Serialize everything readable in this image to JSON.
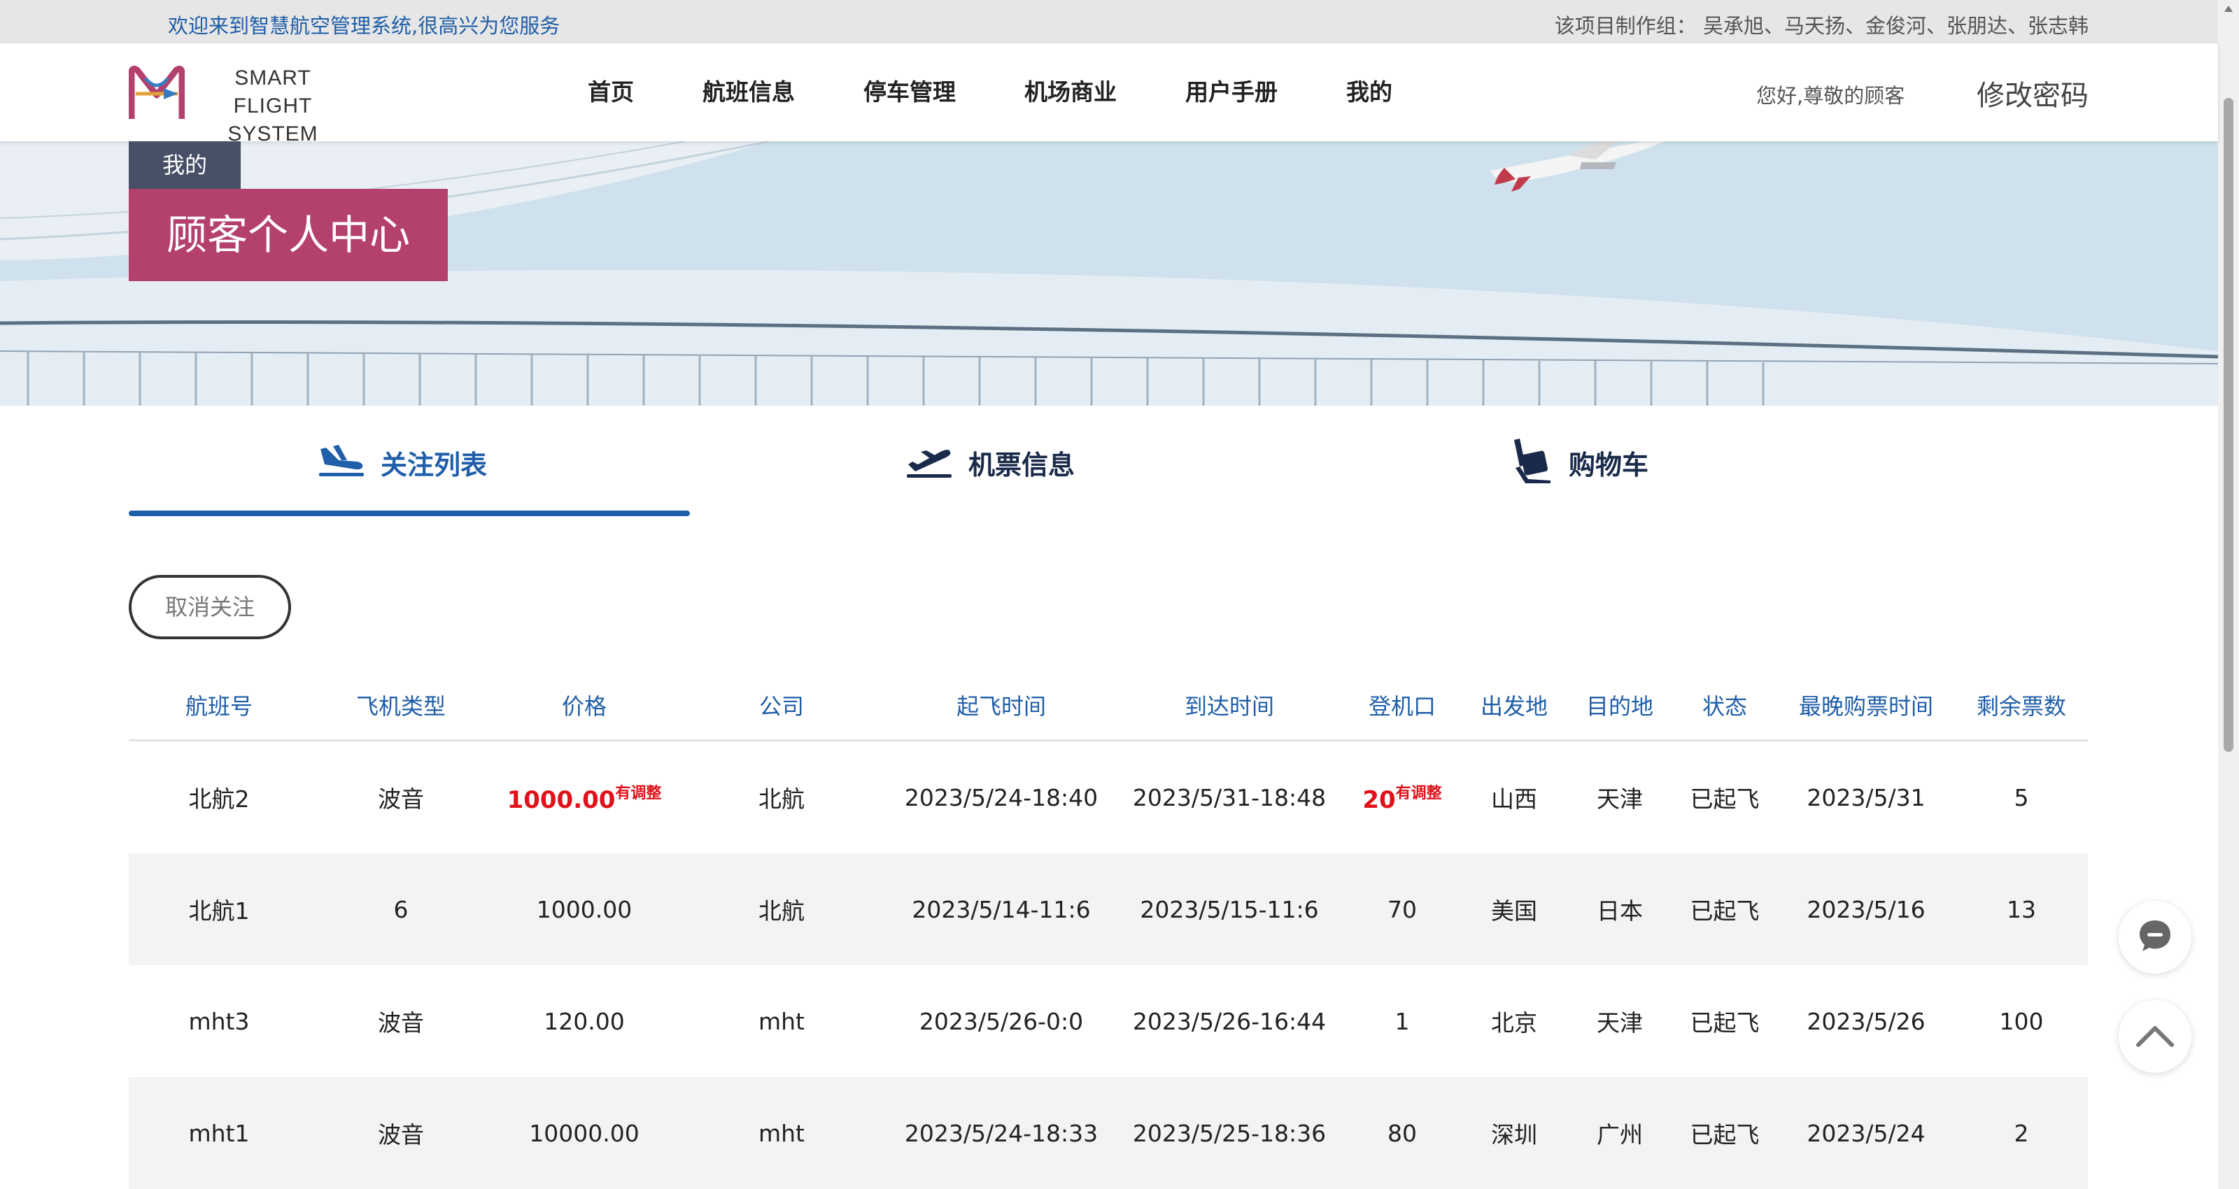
{
  "topbar": {
    "welcome": "欢迎来到智慧航空管理系统,很高兴为您服务",
    "credits": "该项目制作组：  吴承旭、马天扬、金俊河、张朋达、张志韩"
  },
  "header": {
    "logo_line1": "SMART FLIGHT",
    "logo_line2": "SYSTEM",
    "nav": [
      "首页",
      "航班信息",
      "停车管理",
      "机场商业",
      "用户手册",
      "我的"
    ],
    "greeting": "您好,尊敬的顾客",
    "change_password": "修改密码"
  },
  "banner": {
    "tag_small": "我的",
    "tag_big": "顾客个人中心"
  },
  "tabs": [
    {
      "label": "关注列表",
      "icon": "plane-landing-icon",
      "active": true
    },
    {
      "label": "机票信息",
      "icon": "plane-takeoff-icon",
      "active": false
    },
    {
      "label": "购物车",
      "icon": "luggage-cart-icon",
      "active": false
    }
  ],
  "unfollow_button": "取消关注",
  "table": {
    "headers": [
      "航班号",
      "飞机类型",
      "价格",
      "公司",
      "起飞时间",
      "到达时间",
      "登机口",
      "出发地",
      "目的地",
      "状态",
      "最晚购票时间",
      "剩余票数"
    ],
    "rows": [
      {
        "flight": "北航2",
        "plane": "波音",
        "price": "1000.00",
        "price_note": "有调整",
        "company": "北航",
        "depart": "2023/5/24-18:40",
        "arrive": "2023/5/31-18:48",
        "gate": "20",
        "gate_note": "有调整",
        "from": "山西",
        "to": "天津",
        "status": "已起飞",
        "deadline": "2023/5/31",
        "remaining": "5"
      },
      {
        "flight": "北航1",
        "plane": "6",
        "price": "1000.00",
        "company": "北航",
        "depart": "2023/5/14-11:6",
        "arrive": "2023/5/15-11:6",
        "gate": "70",
        "from": "美国",
        "to": "日本",
        "status": "已起飞",
        "deadline": "2023/5/16",
        "remaining": "13"
      },
      {
        "flight": "mht3",
        "plane": "波音",
        "price": "120.00",
        "company": "mht",
        "depart": "2023/5/26-0:0",
        "arrive": "2023/5/26-16:44",
        "gate": "1",
        "from": "北京",
        "to": "天津",
        "status": "已起飞",
        "deadline": "2023/5/26",
        "remaining": "100"
      },
      {
        "flight": "mht1",
        "plane": "波音",
        "price": "10000.00",
        "company": "mht",
        "depart": "2023/5/24-18:33",
        "arrive": "2023/5/25-18:36",
        "gate": "80",
        "from": "深圳",
        "to": "广州",
        "status": "已起飞",
        "deadline": "2023/5/24",
        "remaining": "2"
      }
    ]
  },
  "floating": {
    "chat_icon": "chat-bubble-icon",
    "top_icon": "chevron-up-icon"
  },
  "colors": {
    "accent": "#1f5ea8",
    "tag_pink": "#b4406d",
    "tag_dark": "#475066",
    "alert_red": "#e0111a"
  }
}
